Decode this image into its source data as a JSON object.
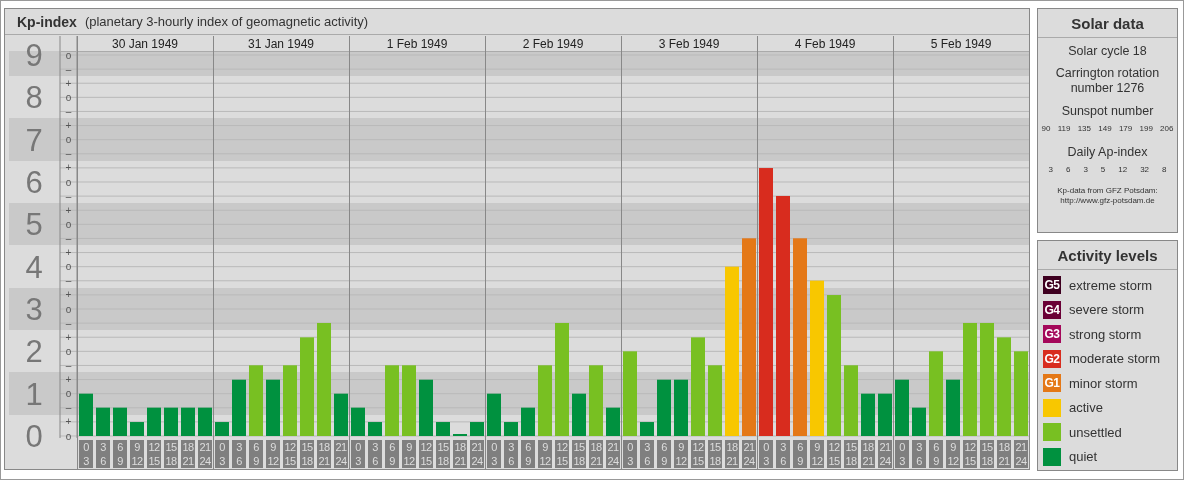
{
  "header": {
    "title": "Kp-index",
    "subtitle": "(planetary 3-hourly index of geomagnetic activity)"
  },
  "kp_chart": {
    "day_labels": [
      "30 Jan 1949",
      "31 Jan 1949",
      "1 Feb 1949",
      "2 Feb 1949",
      "3 Feb 1949",
      "4 Feb 1949",
      "5 Feb 1949"
    ],
    "minor_ticks": [
      "o",
      "–",
      "+",
      "o",
      "–",
      "+",
      "o",
      "–",
      "+",
      "o",
      "–",
      "+",
      "o",
      "–",
      "+",
      "o",
      "–",
      "+",
      "o",
      "–",
      "+",
      "o",
      "–",
      "+",
      "o",
      "–",
      "+",
      "o"
    ],
    "chart_data": {
      "type": "bar",
      "ylim": [
        0,
        9
      ],
      "grid": true,
      "categories": [
        "0\n3",
        "3\n6",
        "6\n9",
        "9\n12",
        "12\n15",
        "15\n18",
        "18\n21",
        "21\n24",
        "0\n3",
        "3\n6",
        "6\n9",
        "9\n12",
        "12\n15",
        "15\n18",
        "18\n21",
        "21\n24",
        "0\n3",
        "3\n6",
        "6\n9",
        "9\n12",
        "12\n15",
        "15\n18",
        "18\n21",
        "21\n24",
        "0\n3",
        "3\n6",
        "6\n9",
        "9\n12",
        "12\n15",
        "15\n18",
        "18\n21",
        "21\n24",
        "0\n3",
        "3\n6",
        "6\n9",
        "9\n12",
        "12\n15",
        "15\n18",
        "18\n21",
        "21\n24",
        "0\n3",
        "3\n6",
        "6\n9",
        "9\n12",
        "12\n15",
        "15\n18",
        "18\n21",
        "21\n24",
        "0\n3",
        "3\n6",
        "6\n9",
        "9\n12",
        "12\n15",
        "15\n18",
        "18\n21",
        "21\n24"
      ],
      "series": [
        {
          "values": [
            1,
            0.67,
            0.67,
            0.33,
            0.67,
            0.67,
            0.67,
            0.67,
            0.33,
            1.33,
            1.67,
            1.33,
            1.67,
            2.33,
            2.67,
            1,
            0.67,
            0.33,
            1.67,
            1.67,
            1.33,
            0.33,
            0,
            0.33,
            1,
            0.33,
            0.67,
            1.67,
            2.67,
            1,
            1.67,
            0.67,
            2,
            0.33,
            1.33,
            1.33,
            2.33,
            1.67,
            4,
            4.67,
            6.33,
            5.67,
            4.67,
            3.67,
            3.33,
            1.67,
            1,
            1,
            1.33,
            0.67,
            2,
            1.33,
            2.67,
            2.67,
            2.33,
            2
          ]
        }
      ],
      "yticks": [
        {
          "value": 0,
          "label": "0"
        },
        {
          "value": 1,
          "label": "1"
        },
        {
          "value": 2,
          "label": "2"
        },
        {
          "value": 3,
          "label": "3"
        },
        {
          "value": 4,
          "label": "4"
        },
        {
          "value": 5,
          "label": "5"
        },
        {
          "value": 6,
          "label": "6"
        },
        {
          "value": 7,
          "label": "7"
        },
        {
          "value": 8,
          "label": "8"
        },
        {
          "value": 9,
          "label": "9"
        }
      ]
    }
  },
  "solar_data": {
    "title": "Solar data",
    "solar_cycle": "Solar cycle 18",
    "carrington": "Carrington rotation number 1276",
    "sunspot_title": "Sunspot number",
    "sunspot_numbers": [
      "90",
      "119",
      "135",
      "149",
      "179",
      "199",
      "206"
    ],
    "ap_title": "Daily Ap-index",
    "ap_values": [
      "3",
      "6",
      "3",
      "5",
      "12",
      "32",
      "8"
    ],
    "source": "Kp-data from GFZ Potsdam:",
    "source_link": "http://www.gfz-potsdam.de"
  },
  "activity_levels": {
    "title": "Activity levels",
    "items": [
      {
        "badge": "G5",
        "label": "extreme storm",
        "color": "#3e0020"
      },
      {
        "badge": "G4",
        "label": "severe storm",
        "color": "#6a0036"
      },
      {
        "badge": "G3",
        "label": "strong storm",
        "color": "#a4085a"
      },
      {
        "badge": "G2",
        "label": "moderate storm",
        "color": "#d82c1e"
      },
      {
        "badge": "G1",
        "label": "minor storm",
        "color": "#e47817"
      },
      {
        "label": "active",
        "color": "#f8c700"
      },
      {
        "label": "unsettled",
        "color": "#78c022"
      },
      {
        "label": "quiet",
        "color": "#00913f"
      }
    ]
  }
}
